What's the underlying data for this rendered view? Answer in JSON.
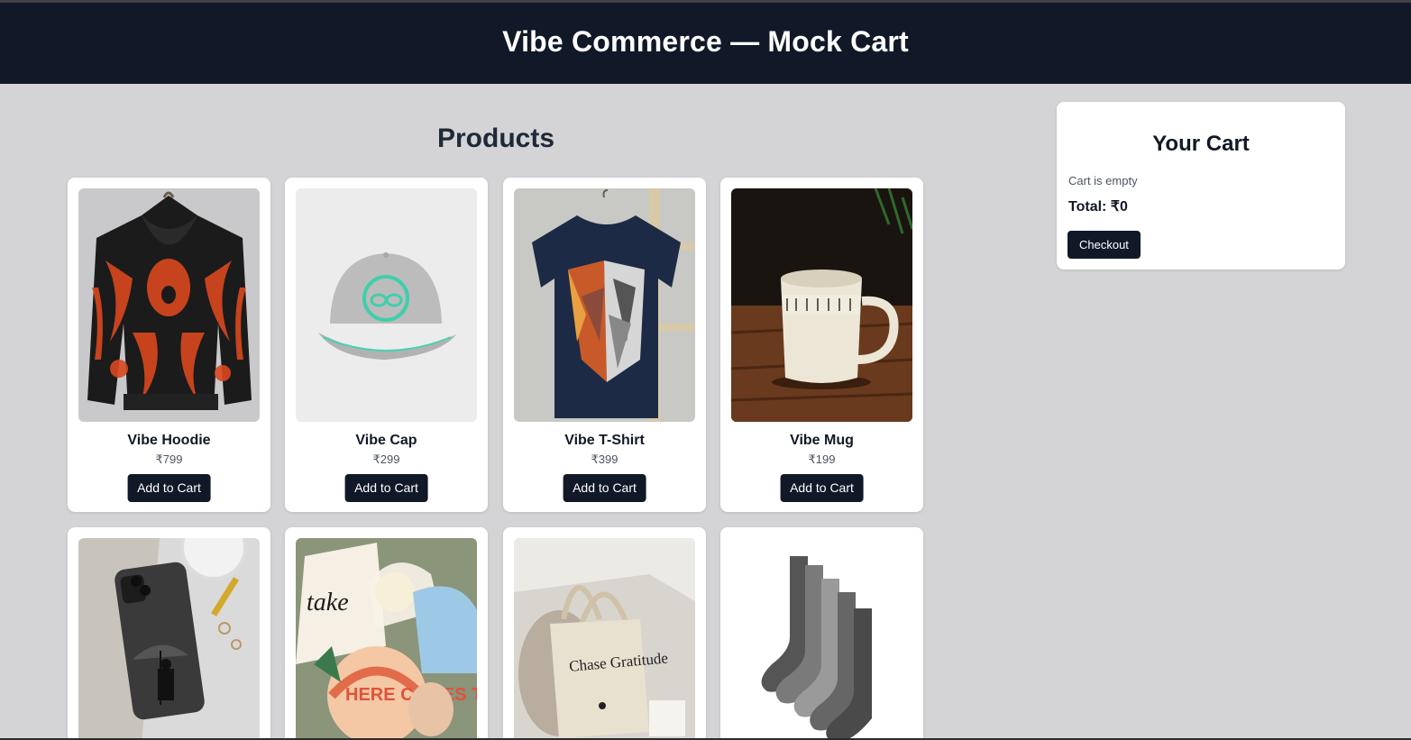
{
  "header": {
    "title": "Vibe Commerce — Mock Cart"
  },
  "products_section": {
    "title": "Products"
  },
  "products": [
    {
      "name": "Vibe Hoodie",
      "price": "₹799",
      "button": "Add to Cart"
    },
    {
      "name": "Vibe Cap",
      "price": "₹299",
      "button": "Add to Cart"
    },
    {
      "name": "Vibe T-Shirt",
      "price": "₹399",
      "button": "Add to Cart"
    },
    {
      "name": "Vibe Mug",
      "price": "₹199",
      "button": "Add to Cart"
    }
  ],
  "product_images_row2": [
    {
      "image_text": "Chase Gratitude"
    },
    {
      "image_text": "HERE COMES THE SUN"
    }
  ],
  "cart": {
    "title": "Your Cart",
    "empty_message": "Cart is empty",
    "total": "Total: ₹0",
    "checkout_label": "Checkout"
  },
  "colors": {
    "header_bg": "#111827",
    "page_bg": "#d4d4d6",
    "button_bg": "#111827"
  }
}
